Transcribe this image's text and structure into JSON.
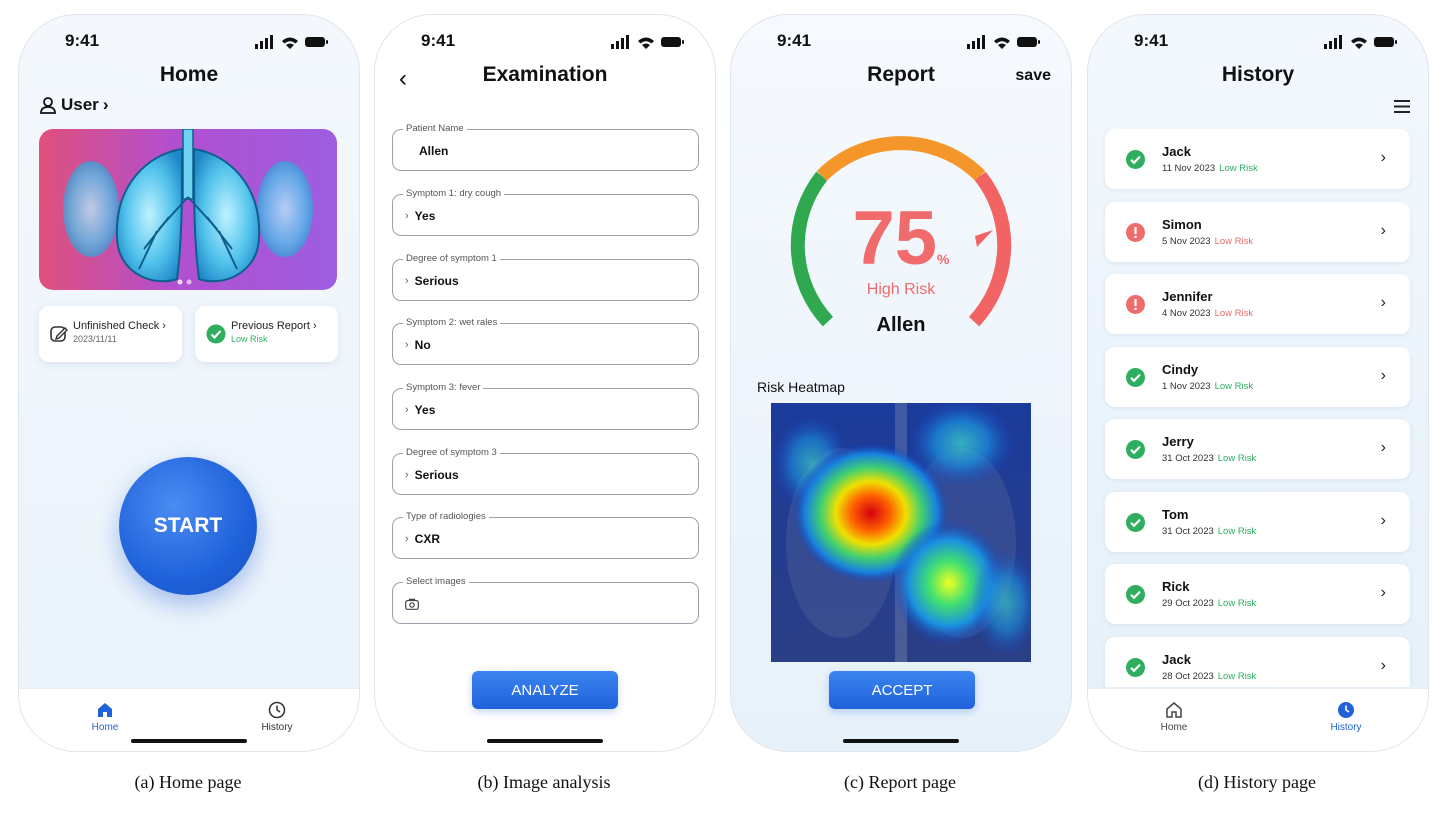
{
  "status": {
    "time": "9:41"
  },
  "home": {
    "title": "Home",
    "user_label": "User",
    "unfinished": {
      "title": "Unfinished Check",
      "date": "2023/11/11"
    },
    "previous": {
      "title": "Previous Report",
      "risk": "Low Risk"
    },
    "start_label": "START",
    "tabs": {
      "home": "Home",
      "history": "History"
    },
    "caption": "(a) Home page"
  },
  "exam": {
    "title": "Examination",
    "fields": [
      {
        "label": "Patient Name",
        "value": "Allen"
      },
      {
        "label": "Symptom 1: dry cough",
        "value": "Yes"
      },
      {
        "label": "Degree of symptom 1",
        "value": "Serious"
      },
      {
        "label": "Symptom 2: wet rales",
        "value": "No"
      },
      {
        "label": "Symptom 3: fever",
        "value": "Yes"
      },
      {
        "label": "Degree of symptom 3",
        "value": "Serious"
      },
      {
        "label": "Type of radiologies",
        "value": "CXR"
      },
      {
        "label": "Select images",
        "value": ""
      }
    ],
    "analyze_label": "ANALYZE",
    "caption": "(b) Image analysis"
  },
  "report": {
    "title": "Report",
    "save_label": "save",
    "risk_value": "75",
    "risk_unit": "%",
    "risk_level": "High Risk",
    "patient": "Allen",
    "heatmap_label": "Risk Heatmap",
    "accept_label": "ACCEPT",
    "caption": "(c) Report page"
  },
  "history": {
    "title": "History",
    "items": [
      {
        "name": "Jack",
        "date": "11 Nov 2023",
        "risk": "Low Risk",
        "status": "ok"
      },
      {
        "name": "Simon",
        "date": "5 Nov 2023",
        "risk": "Low Risk",
        "status": "alert"
      },
      {
        "name": "Jennifer",
        "date": "4 Nov 2023",
        "risk": "Low Risk",
        "status": "alert"
      },
      {
        "name": "Cindy",
        "date": "1 Nov 2023",
        "risk": "Low Risk",
        "status": "ok"
      },
      {
        "name": "Jerry",
        "date": "31 Oct 2023",
        "risk": "Low Risk",
        "status": "ok"
      },
      {
        "name": "Tom",
        "date": "31 Oct 2023",
        "risk": "Low Risk",
        "status": "ok"
      },
      {
        "name": "Rick",
        "date": "29 Oct 2023",
        "risk": "Low Risk",
        "status": "ok"
      },
      {
        "name": "Jack",
        "date": "28 Oct 2023",
        "risk": "Low Risk",
        "status": "ok"
      }
    ],
    "tabs": {
      "home": "Home",
      "history": "History"
    },
    "caption": "(d) History page"
  },
  "colors": {
    "primary": "#1f62db",
    "low_risk": "#2fae5f",
    "high_risk": "#f06b6b",
    "gauge_green": "#2fa84f",
    "gauge_orange": "#f5962a",
    "gauge_red": "#f26363"
  }
}
